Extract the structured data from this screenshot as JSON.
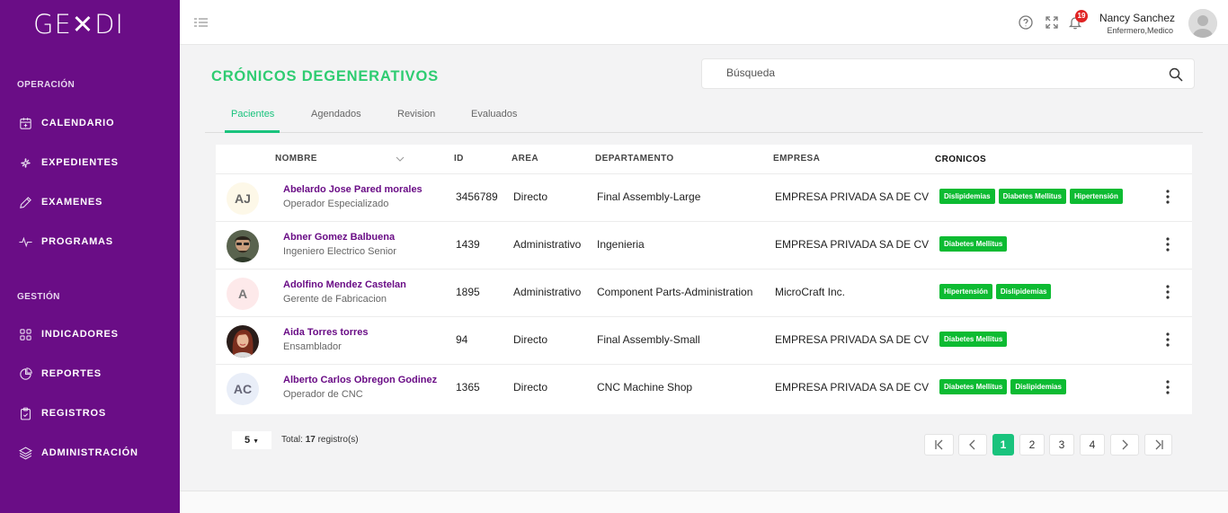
{
  "app": {
    "logo_text": "GE✕DI"
  },
  "sidebar": {
    "sections": [
      "OPERACIÓN",
      "GESTIÓN"
    ],
    "items": [
      {
        "label": "CALENDARIO",
        "icon": "calendar-icon"
      },
      {
        "label": "EXPEDIENTES",
        "icon": "flower-icon"
      },
      {
        "label": "EXAMENES",
        "icon": "pencil-icon"
      },
      {
        "label": "PROGRAMAS",
        "icon": "pulse-icon"
      },
      {
        "label": "INDICADORES",
        "icon": "grid-icon"
      },
      {
        "label": "REPORTES",
        "icon": "pie-chart-icon"
      },
      {
        "label": "REGISTROS",
        "icon": "clipboard-icon"
      },
      {
        "label": "ADMINISTRACIÓN",
        "icon": "layers-icon"
      }
    ]
  },
  "topbar": {
    "notifications_count": "19",
    "user_name": "Nancy Sanchez",
    "user_role": "Enfermero,Medico"
  },
  "main": {
    "title": "CRÓNICOS DEGENERATIVOS",
    "search_placeholder": "Búsqueda",
    "tabs": [
      "Pacientes",
      "Agendados",
      "Revision",
      "Evaluados"
    ],
    "active_tab": "Pacientes"
  },
  "table": {
    "headers": {
      "nombre": "NOMBRE",
      "id": "ID",
      "area": "AREA",
      "departamento": "DEPARTAMENTO",
      "empresa": "EMPRESA",
      "cronicos": "CRONICOS"
    },
    "rows": [
      {
        "initials": "AJ",
        "name": "Abelardo Jose Pared morales",
        "role": "Operador Especializado",
        "id": "3456789",
        "area": "Directo",
        "departamento": "Final Assembly-Large",
        "empresa": "EMPRESA PRIVADA SA DE CV",
        "tags": [
          "Dislipidemias",
          "Diabetes Mellitus",
          "Hipertensión"
        ]
      },
      {
        "initials": "",
        "name": "Abner Gomez Balbuena",
        "role": "Ingeniero Electrico Senior",
        "id": "1439",
        "area": "Administrativo",
        "departamento": "Ingenieria",
        "empresa": "EMPRESA PRIVADA SA DE CV",
        "tags": [
          "Diabetes Mellitus"
        ]
      },
      {
        "initials": "A",
        "name": "Adolfino Mendez Castelan",
        "role": "Gerente de Fabricacion",
        "id": "1895",
        "area": "Administrativo",
        "departamento": "Component Parts-Administration",
        "empresa": "MicroCraft Inc.",
        "tags": [
          "Hipertensión",
          "Dislipidemias"
        ]
      },
      {
        "initials": "",
        "name": "Aida Torres torres",
        "role": "Ensamblador",
        "id": "94",
        "area": "Directo",
        "departamento": "Final Assembly-Small",
        "empresa": "EMPRESA PRIVADA SA DE CV",
        "tags": [
          "Diabetes Mellitus"
        ]
      },
      {
        "initials": "AC",
        "name": "Alberto Carlos Obregon Godinez",
        "role": "Operador de CNC",
        "id": "1365",
        "area": "Directo",
        "departamento": "CNC Machine Shop",
        "empresa": "EMPRESA PRIVADA SA DE CV",
        "tags": [
          "Diabetes Mellitus",
          "Dislipidemias"
        ]
      }
    ]
  },
  "pagination": {
    "page_size": "5",
    "total_label": "Total:",
    "total_count": "17",
    "total_suffix": "registro(s)",
    "pages": [
      "1",
      "2",
      "3",
      "4"
    ],
    "current_page": "1"
  },
  "colors": {
    "sidebar": "#6a0d86",
    "accent": "#19c37d",
    "title": "#2ecc71",
    "tag": "#0dbb32",
    "badge": "#e02424"
  }
}
